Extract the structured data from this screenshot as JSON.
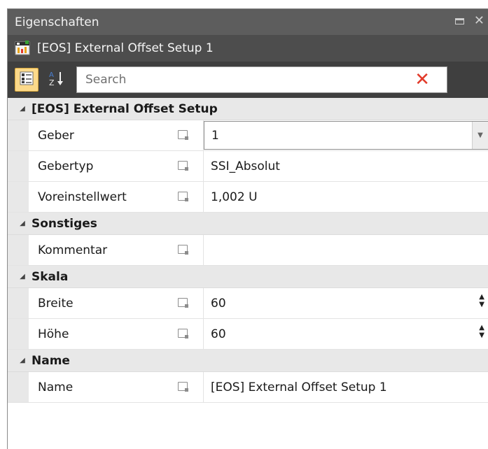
{
  "window": {
    "title": "Eigenschaften",
    "maximize_icon": "maximize-icon",
    "close_icon": "close-icon"
  },
  "object": {
    "name": "[EOS] External Offset Setup 1",
    "icon": "object-icon"
  },
  "toolbar": {
    "categorized_icon": "categorized-view-icon",
    "alphabetical_icon": "sort-alphabetical-icon",
    "search_placeholder": "Search",
    "search_value": "",
    "clear_icon": "clear-icon"
  },
  "categories": [
    {
      "label": "[EOS] External Offset Setup",
      "rows": [
        {
          "name": "Geber",
          "value": "1",
          "control": "dropdown"
        },
        {
          "name": "Gebertyp",
          "value": "SSI_Absolut",
          "control": "text"
        },
        {
          "name": "Voreinstellwert",
          "value": "1,002 U",
          "control": "text"
        }
      ]
    },
    {
      "label": "Sonstiges",
      "rows": [
        {
          "name": "Kommentar",
          "value": "",
          "control": "text"
        }
      ]
    },
    {
      "label": "Skala",
      "rows": [
        {
          "name": "Breite",
          "value": "60",
          "control": "spinner"
        },
        {
          "name": "Höhe",
          "value": "60",
          "control": "spinner"
        }
      ]
    },
    {
      "label": "Name",
      "rows": [
        {
          "name": "Name",
          "value": "[EOS] External Offset Setup 1",
          "control": "text"
        }
      ]
    }
  ],
  "colors": {
    "title_bar": "#5d5d5d",
    "object_bar": "#4d4d4d",
    "toolbar": "#3f3f3f",
    "active_toggle": "#fbd98a",
    "clear_x": "#e23a2a",
    "category_bg": "#e8e8e8"
  }
}
